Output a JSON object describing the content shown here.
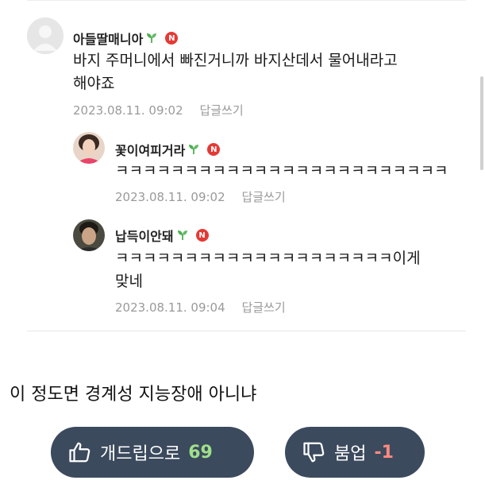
{
  "comments": [
    {
      "author": "아들딸매니아",
      "text_lines": [
        "바지 주머니에서 빠진거니까 바지산데서 물어내라고",
        "해야죠"
      ],
      "timestamp": "2023.08.11. 09:02",
      "reply_label": "답글쓰기",
      "badge": "N"
    },
    {
      "author": "꽃이여피거라",
      "text_lines": [
        "ㅋㅋㅋㅋㅋㅋㅋㅋㅋㅋㅋㅋㅋㅋㅋㅋㅋㅋㅋㅋㅋㅋㅋㅋ"
      ],
      "timestamp": "2023.08.11. 09:02",
      "reply_label": "답글쓰기",
      "badge": "N"
    },
    {
      "author": "납득이안돼",
      "text_lines": [
        "ㅋㅋㅋㅋㅋㅋㅋㅋㅋㅋㅋㅋㅋㅋㅋㅋㅋㅋㅋㅋ이게",
        "맞네"
      ],
      "timestamp": "2023.08.11. 09:04",
      "reply_label": "답글쓰기",
      "badge": "N"
    }
  ],
  "post": {
    "body_text": "이 정도면 경계성 지능장애 아니냐"
  },
  "vote": {
    "up_label": "개드립으로",
    "up_count": "69",
    "down_label": "붐업",
    "down_count": "-1"
  },
  "colors": {
    "vote_bg": "#3c4a5e",
    "up_count": "#9fe08a",
    "down_count": "#ff8a80",
    "badge": "#e53935",
    "sprout": "#4caf50"
  }
}
